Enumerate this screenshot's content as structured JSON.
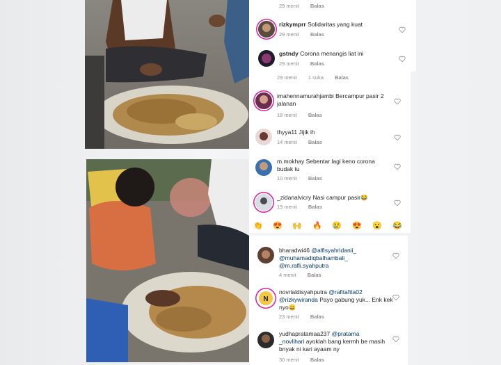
{
  "panel1": {
    "comments": [
      {
        "username": "",
        "text": "",
        "time": "29 menit",
        "reply": "Balas"
      },
      {
        "username": "rizkymprr",
        "text": "Solidaritas yang kuat",
        "time": "29 menit",
        "reply": "Balas"
      },
      {
        "username": "gstndy",
        "text": "Corona menangis liat ini",
        "time": "29 menit",
        "reply": "Balas"
      }
    ]
  },
  "panel2": {
    "top_meta": {
      "time": "29 menit",
      "likes": "1 suka",
      "reply": "Balas"
    },
    "comments": [
      {
        "username": "imahennamurahjambi",
        "text": "Bercampur pasir 2 jalanan",
        "time": "18 menit",
        "reply": "Balas"
      },
      {
        "username": "thyya11",
        "text": "Jijik ih",
        "time": "14 menit",
        "reply": "Balas"
      },
      {
        "username": "m.mokhay",
        "text": "Sebentar lagi keno corona budak tu",
        "time": "10 menit",
        "reply": "Balas"
      },
      {
        "username": "_zidanalvicry",
        "text": "Nasi campur pasir😂",
        "time": "19 menit",
        "reply": "Balas"
      }
    ],
    "emoji_bar": [
      "👏",
      "😍",
      "🙌",
      "🔥",
      "😢",
      "😍",
      "😮",
      "😂"
    ]
  },
  "panel3": {
    "comments": [
      {
        "username": "bharadwi46",
        "mention1": "@alfisyahridanii_",
        "mention2": "@muhamadiqbalhambali_",
        "mention3": "@m.rafli.syahputra",
        "time": "4 menit",
        "reply": "Balas"
      },
      {
        "username": "novrialdisyahputra",
        "mention1": "@rafitafita02",
        "mention2": "@rizkywiranda",
        "text": "Payo gabung yuk... Enk kek nyo😀",
        "time": "23 menit",
        "reply": "Balas"
      },
      {
        "username": "yudhapratamaa237",
        "mention1": "@pratama",
        "mention2": "_novlihari",
        "text": "ayoklah bang kermh be masih bnyak ni kari ayaam ny",
        "time": "30 menit",
        "reply": "Balas"
      }
    ]
  },
  "colors": {
    "mention": "#00376b",
    "meta": "#8e8e8e",
    "story_ring": "#d6249f"
  }
}
